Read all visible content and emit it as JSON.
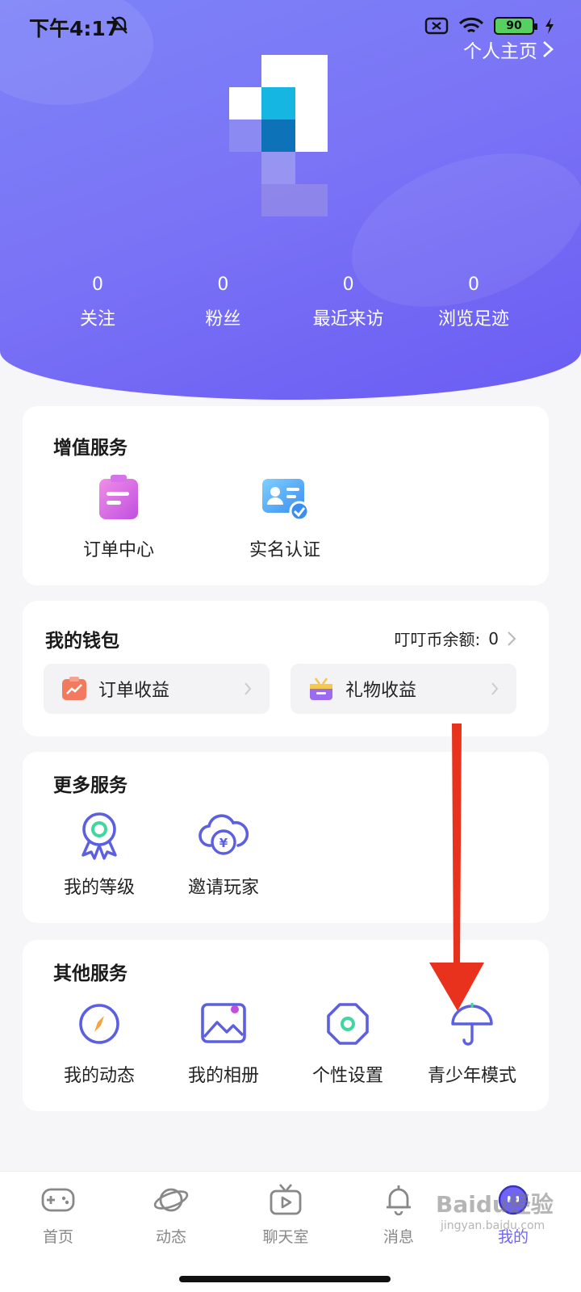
{
  "status_bar": {
    "time": "下午4:17",
    "battery": "90"
  },
  "header": {
    "profile_link": "个人主页",
    "stats": [
      {
        "value": "0",
        "label": "关注"
      },
      {
        "value": "0",
        "label": "粉丝"
      },
      {
        "value": "0",
        "label": "最近来访"
      },
      {
        "value": "0",
        "label": "浏览足迹"
      }
    ]
  },
  "value_added": {
    "title": "增值服务",
    "items": [
      {
        "label": "订单中心",
        "icon": "order-clipboard-icon"
      },
      {
        "label": "实名认证",
        "icon": "id-card-verify-icon"
      }
    ]
  },
  "wallet": {
    "title": "我的钱包",
    "balance_label": "叮叮币余额:",
    "balance_value": "0",
    "buttons": [
      {
        "label": "订单收益",
        "icon": "chart-income-icon"
      },
      {
        "label": "礼物收益",
        "icon": "gift-box-icon"
      }
    ]
  },
  "more_services": {
    "title": "更多服务",
    "items": [
      {
        "label": "我的等级",
        "icon": "medal-icon"
      },
      {
        "label": "邀请玩家",
        "icon": "cloud-coin-icon"
      }
    ]
  },
  "other_services": {
    "title": "其他服务",
    "items": [
      {
        "label": "我的动态",
        "icon": "compass-icon"
      },
      {
        "label": "我的相册",
        "icon": "picture-icon"
      },
      {
        "label": "个性设置",
        "icon": "settings-octagon-icon"
      },
      {
        "label": "青少年模式",
        "icon": "umbrella-icon"
      }
    ]
  },
  "bottom_nav": [
    {
      "label": "首页",
      "icon": "gamepad-icon"
    },
    {
      "label": "动态",
      "icon": "planet-icon"
    },
    {
      "label": "聊天室",
      "icon": "tv-play-icon"
    },
    {
      "label": "消息",
      "icon": "bell-icon"
    },
    {
      "label": "我的",
      "icon": "face-icon",
      "active": true
    }
  ],
  "watermark": {
    "brand": "Baidu经验",
    "url": "jingyan.baidu.com"
  },
  "colors": {
    "accent": "#6f64f5",
    "header_start": "#7c83f8",
    "header_end": "#6a5cf3",
    "arrow": "#e8321e"
  }
}
